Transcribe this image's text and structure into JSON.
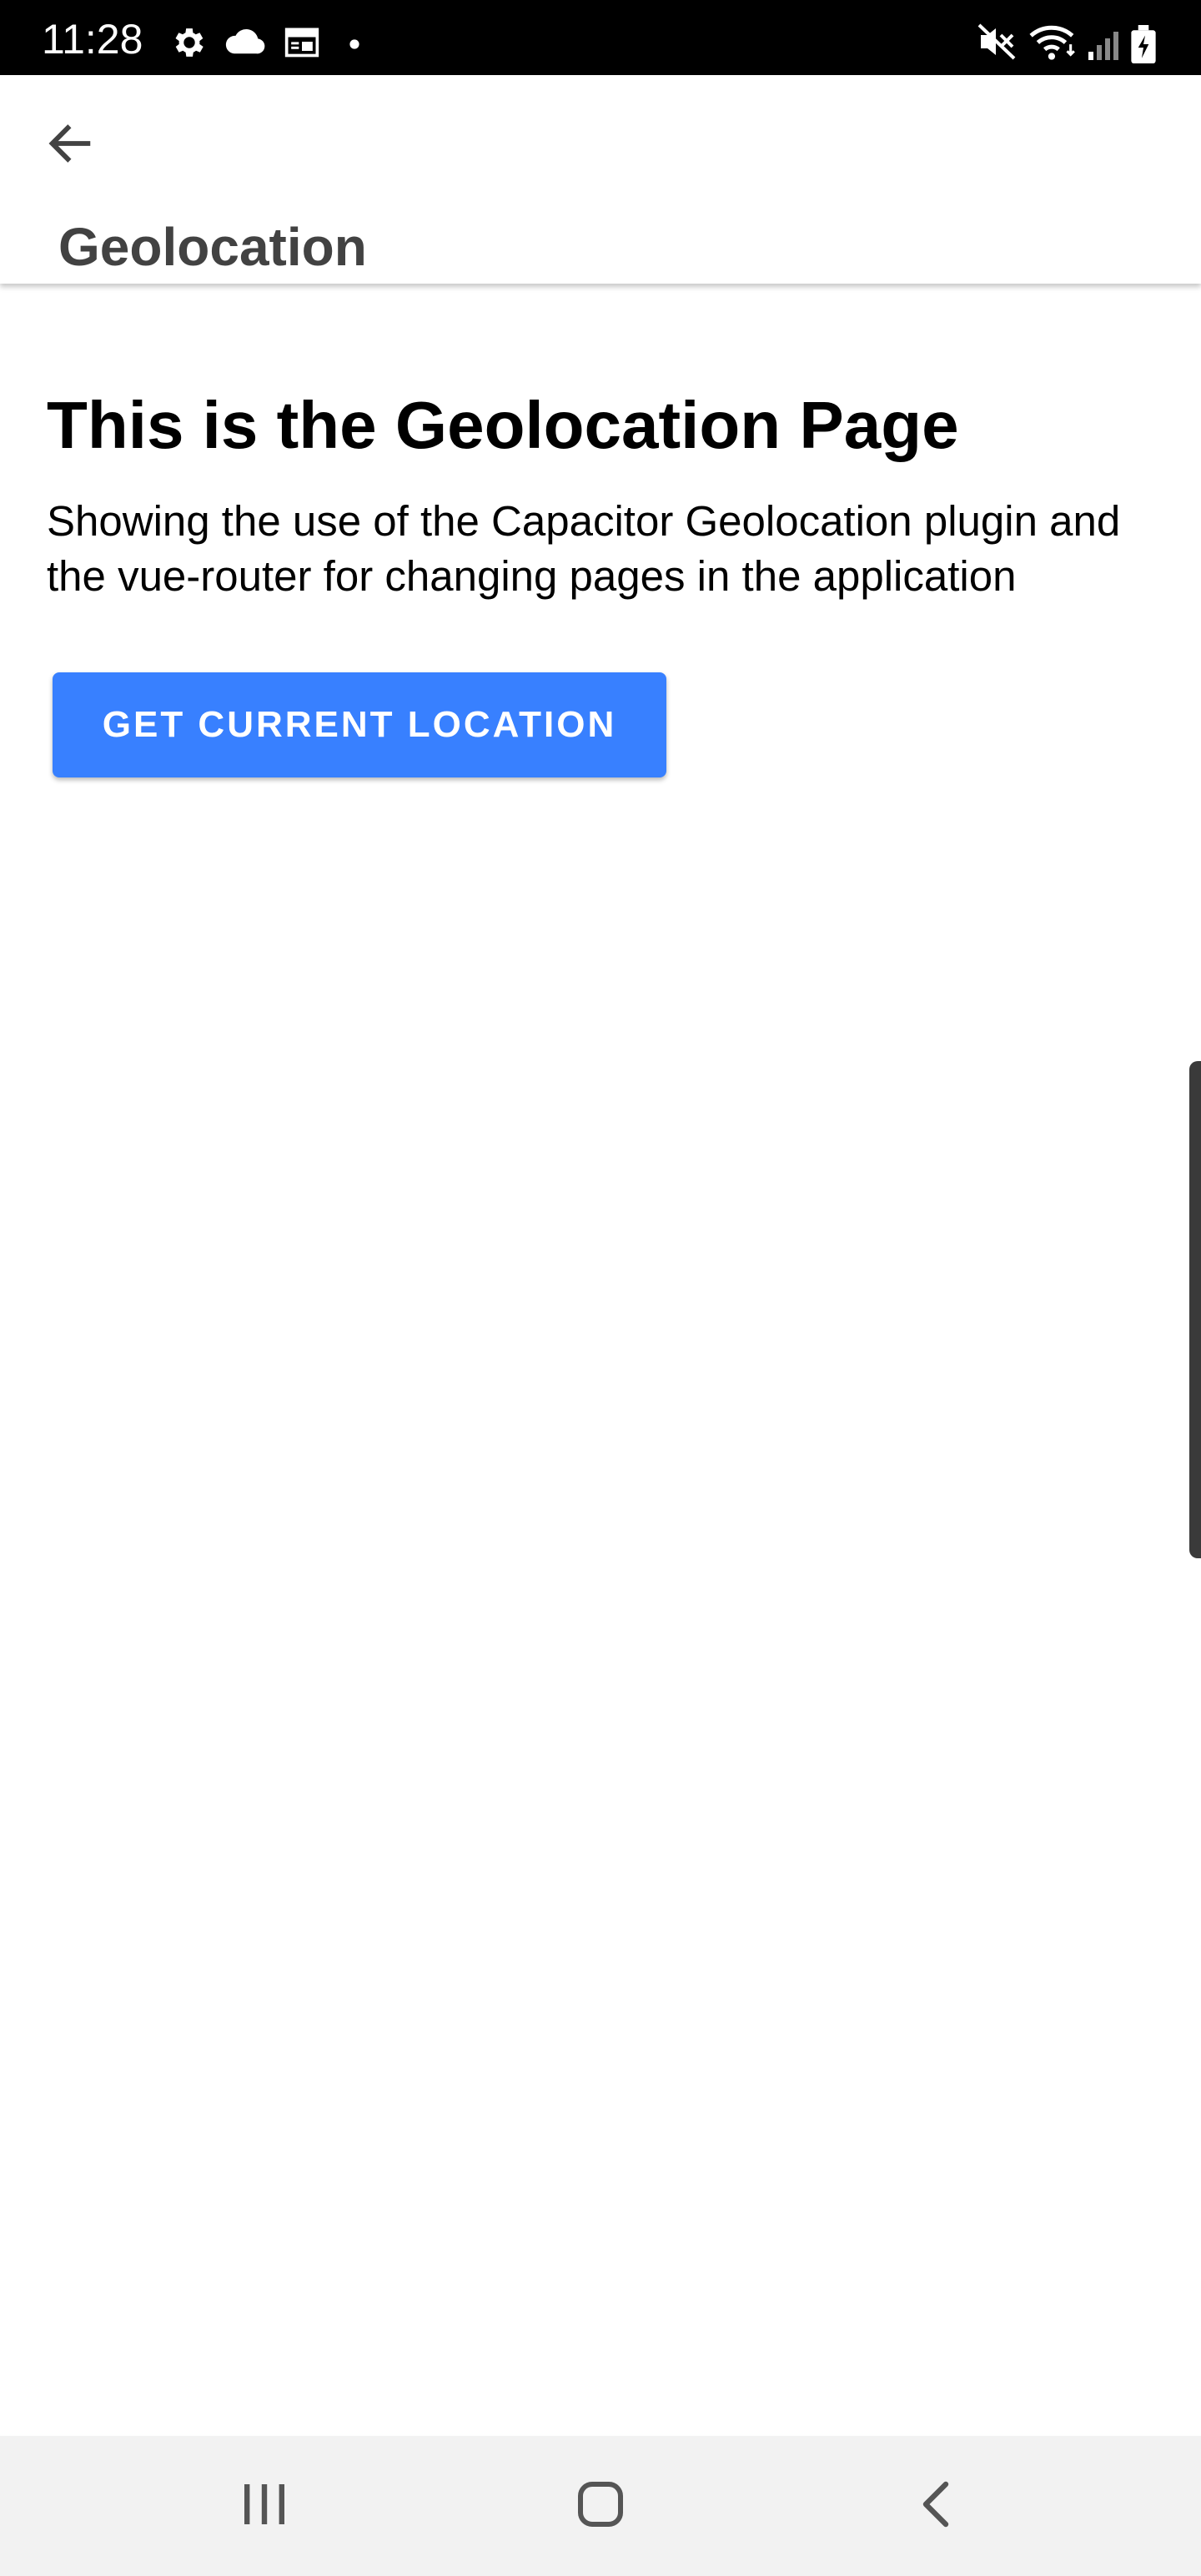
{
  "status_bar": {
    "time": "11:28",
    "icons": [
      "gear-icon",
      "cloud-icon",
      "calendar-icon",
      "dot-icon",
      "mute-icon",
      "wifi-icon",
      "signal-icon",
      "battery-icon"
    ]
  },
  "toolbar": {
    "back_icon": "arrow-back-icon",
    "title": "Geolocation"
  },
  "content": {
    "heading": "This is the Geolocation Page",
    "description": "Showing the use of the Capacitor Geolocation plugin and the vue-router for changing pages in the application",
    "button_label": "GET CURRENT LOCATION"
  },
  "nav_bar": {
    "icons": [
      "recent-apps-icon",
      "home-icon",
      "back-icon"
    ]
  },
  "colors": {
    "primary": "#3880ff",
    "status_bar": "#000000",
    "nav_bar": "#f2f2f2",
    "title_text": "#424242"
  }
}
